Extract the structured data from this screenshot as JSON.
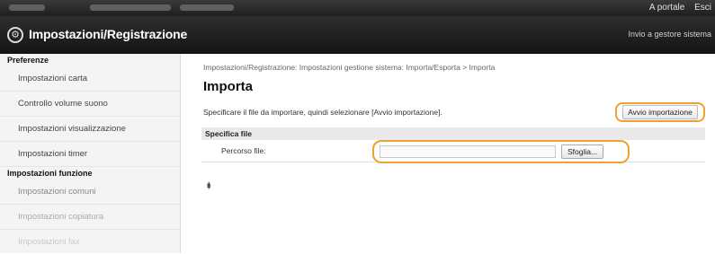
{
  "topbar": {
    "links": [
      "A portale",
      "Esci"
    ]
  },
  "header": {
    "title": "Impostazioni/Registrazione",
    "right_link": "Invio a gestore sistema"
  },
  "sidebar": {
    "sections": [
      {
        "title": "Preferenze",
        "items": [
          "Impostazioni carta",
          "Controllo volume suono",
          "Impostazioni visualizzazione",
          "Impostazioni timer"
        ]
      },
      {
        "title": "Impostazioni funzione",
        "items": [
          "Impostazioni comuni",
          "Impostazioni copiatura",
          "Impostazioni fax"
        ]
      }
    ]
  },
  "main": {
    "breadcrumb": "Impostazioni/Registrazione: Impostazioni gestione sistema: Importa/Esporta > Importa",
    "title": "Importa",
    "instruction": "Specificare il file da importare, quindi selezionare [Avvio importazione].",
    "start_button": "Avvio importazione",
    "spec_section": "Specifica file",
    "file_path_label": "Percorso file:",
    "browse_button": "Sfoglia...",
    "top_icon": "⯒"
  },
  "colors": {
    "highlight": "#f0a030",
    "header_bg": "#1e1e1e"
  }
}
